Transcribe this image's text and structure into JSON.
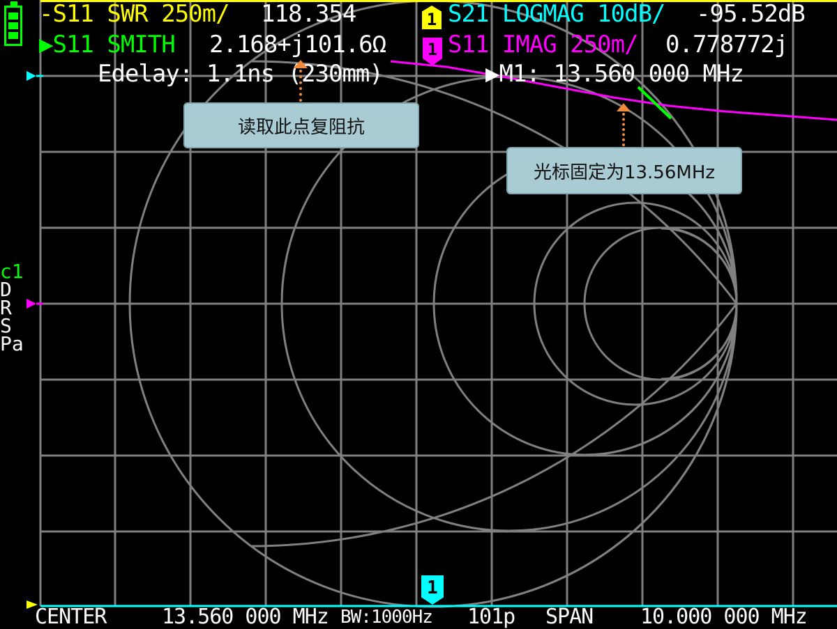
{
  "colors": {
    "bg": "#000000",
    "grid": "#808080",
    "ch0_yellow": "#ffff00",
    "ch0_green": "#00ff00",
    "ch1_cyan": "#00ffff",
    "trace_magenta": "#ff00ff",
    "value_white": "#ffffff",
    "callout_bg": "#a9cbd3",
    "arrow_orange": "#f08a3c"
  },
  "traces": {
    "swr": {
      "label": "S11 SWR 250m/",
      "value": "118.354"
    },
    "logmag": {
      "label": "S21 LOGMAG 10dB/",
      "value": "-95.52dB"
    },
    "smith": {
      "label": "S11 SMITH",
      "value": "2.168+j101.6Ω"
    },
    "imag": {
      "label": "S11 IMAG 250m/",
      "value": "0.778772j"
    }
  },
  "marker_flags": {
    "top_yellow": "1",
    "top_magenta": "1",
    "bottom_cyan": "1"
  },
  "edelay": "Edelay: 1.1ns (230mm)",
  "marker_readout": "M1: 13.560 000 MHz",
  "side_labels": {
    "cal": "c1",
    "d": "D",
    "r": "R",
    "s": "S",
    "pa": "Pa"
  },
  "footer": {
    "center_label": "CENTER",
    "center_value": "13.560 000 MHz",
    "bw": "BW:1000Hz",
    "points": "101p",
    "span_label": "SPAN",
    "span_value": "10.000 000 MHz"
  },
  "callouts": {
    "impedance": "读取此点复阻抗",
    "cursor": "光标固定为13.56MHz"
  },
  "icons": {
    "battery": "battery-icon"
  }
}
